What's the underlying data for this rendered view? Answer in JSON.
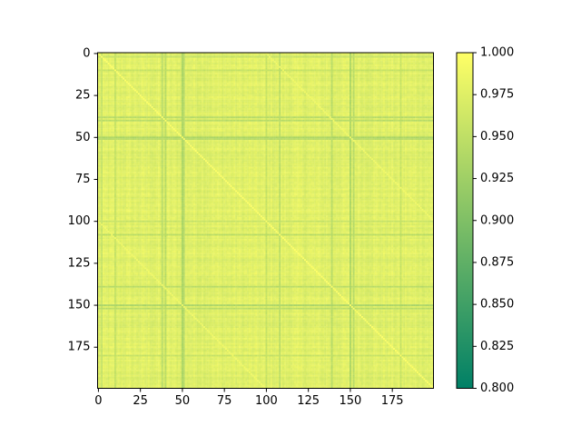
{
  "chart_data": {
    "type": "heatmap",
    "title": "",
    "xlabel": "",
    "ylabel": "",
    "matrix_size": 200,
    "xlim": [
      0,
      199
    ],
    "ylim": [
      199,
      0
    ],
    "x_ticks": [
      0,
      25,
      50,
      75,
      100,
      125,
      150,
      175
    ],
    "y_ticks": [
      0,
      25,
      50,
      75,
      100,
      125,
      150,
      175
    ],
    "colormap": "summer",
    "color_range": [
      0.8,
      1.0
    ],
    "diagonal_value": 1.0,
    "typical_value": 0.975,
    "notable_low_rows_cols": [
      {
        "index": 2,
        "value": 0.955
      },
      {
        "index": 10,
        "value": 0.955
      },
      {
        "index": 38,
        "value": 0.945
      },
      {
        "index": 40,
        "value": 0.945
      },
      {
        "index": 50,
        "value": 0.935
      },
      {
        "index": 51,
        "value": 0.945
      },
      {
        "index": 100,
        "value": 0.955
      },
      {
        "index": 108,
        "value": 0.945
      },
      {
        "index": 139,
        "value": 0.945
      },
      {
        "index": 150,
        "value": 0.935
      },
      {
        "index": 152,
        "value": 0.945
      },
      {
        "index": 180,
        "value": 0.955
      }
    ],
    "secondary_diagonals": [
      {
        "offset": 100,
        "value": 0.99
      }
    ],
    "colorbar": {
      "ticks": [
        "0.800",
        "0.825",
        "0.850",
        "0.875",
        "0.900",
        "0.925",
        "0.950",
        "0.975",
        "1.000"
      ]
    },
    "grid": false,
    "legend": "none"
  }
}
